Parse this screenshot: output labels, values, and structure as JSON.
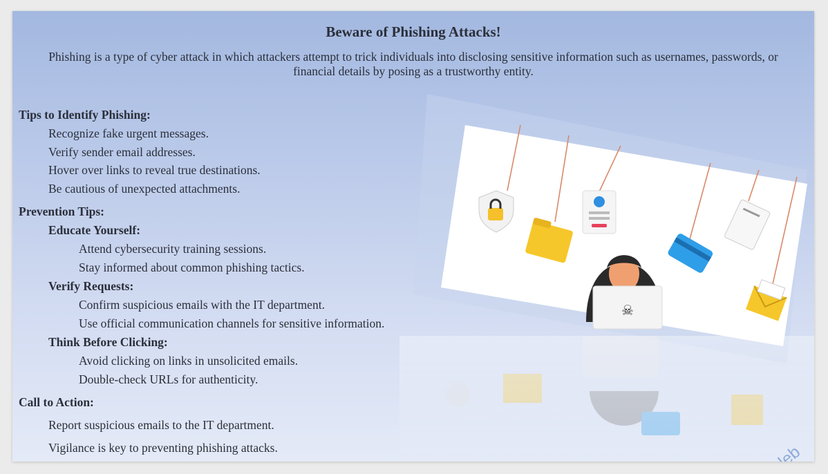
{
  "title": "Beware of Phishing Attacks!",
  "intro": "Phishing is a type of cyber attack in which attackers attempt to trick individuals into disclosing sensitive information such as usernames, passwords, or financial details by posing as a trustworthy entity.",
  "identify": {
    "heading": "Tips to Identify Phishing:",
    "items": [
      "Recognize fake urgent messages.",
      "Verify sender email addresses.",
      "Hover over links to reveal true destinations.",
      "Be cautious of unexpected attachments."
    ]
  },
  "prevention": {
    "heading": "Prevention Tips:",
    "groups": [
      {
        "heading": "Educate Yourself:",
        "items": [
          "Attend cybersecurity training sessions.",
          "Stay informed about common phishing tactics."
        ]
      },
      {
        "heading": "Verify Requests:",
        "items": [
          "Confirm suspicious emails with the IT department.",
          "Use official communication channels for sensitive information."
        ]
      },
      {
        "heading": "Think Before Clicking:",
        "items": [
          "Avoid clicking on links in unsolicited emails.",
          "Double-check URLs for authenticity."
        ]
      }
    ]
  },
  "cta": {
    "heading": "Call to Action:",
    "items": [
      "Report suspicious emails to the IT department.",
      "Vigilance is key to preventing phishing attacks."
    ]
  },
  "watermark": "Caleb",
  "illustration_icons": [
    "padlock-icon",
    "folder-icon",
    "login-form-icon",
    "credit-card-icon",
    "document-icon",
    "envelope-icon",
    "hooded-hacker-icon",
    "laptop-icon"
  ]
}
